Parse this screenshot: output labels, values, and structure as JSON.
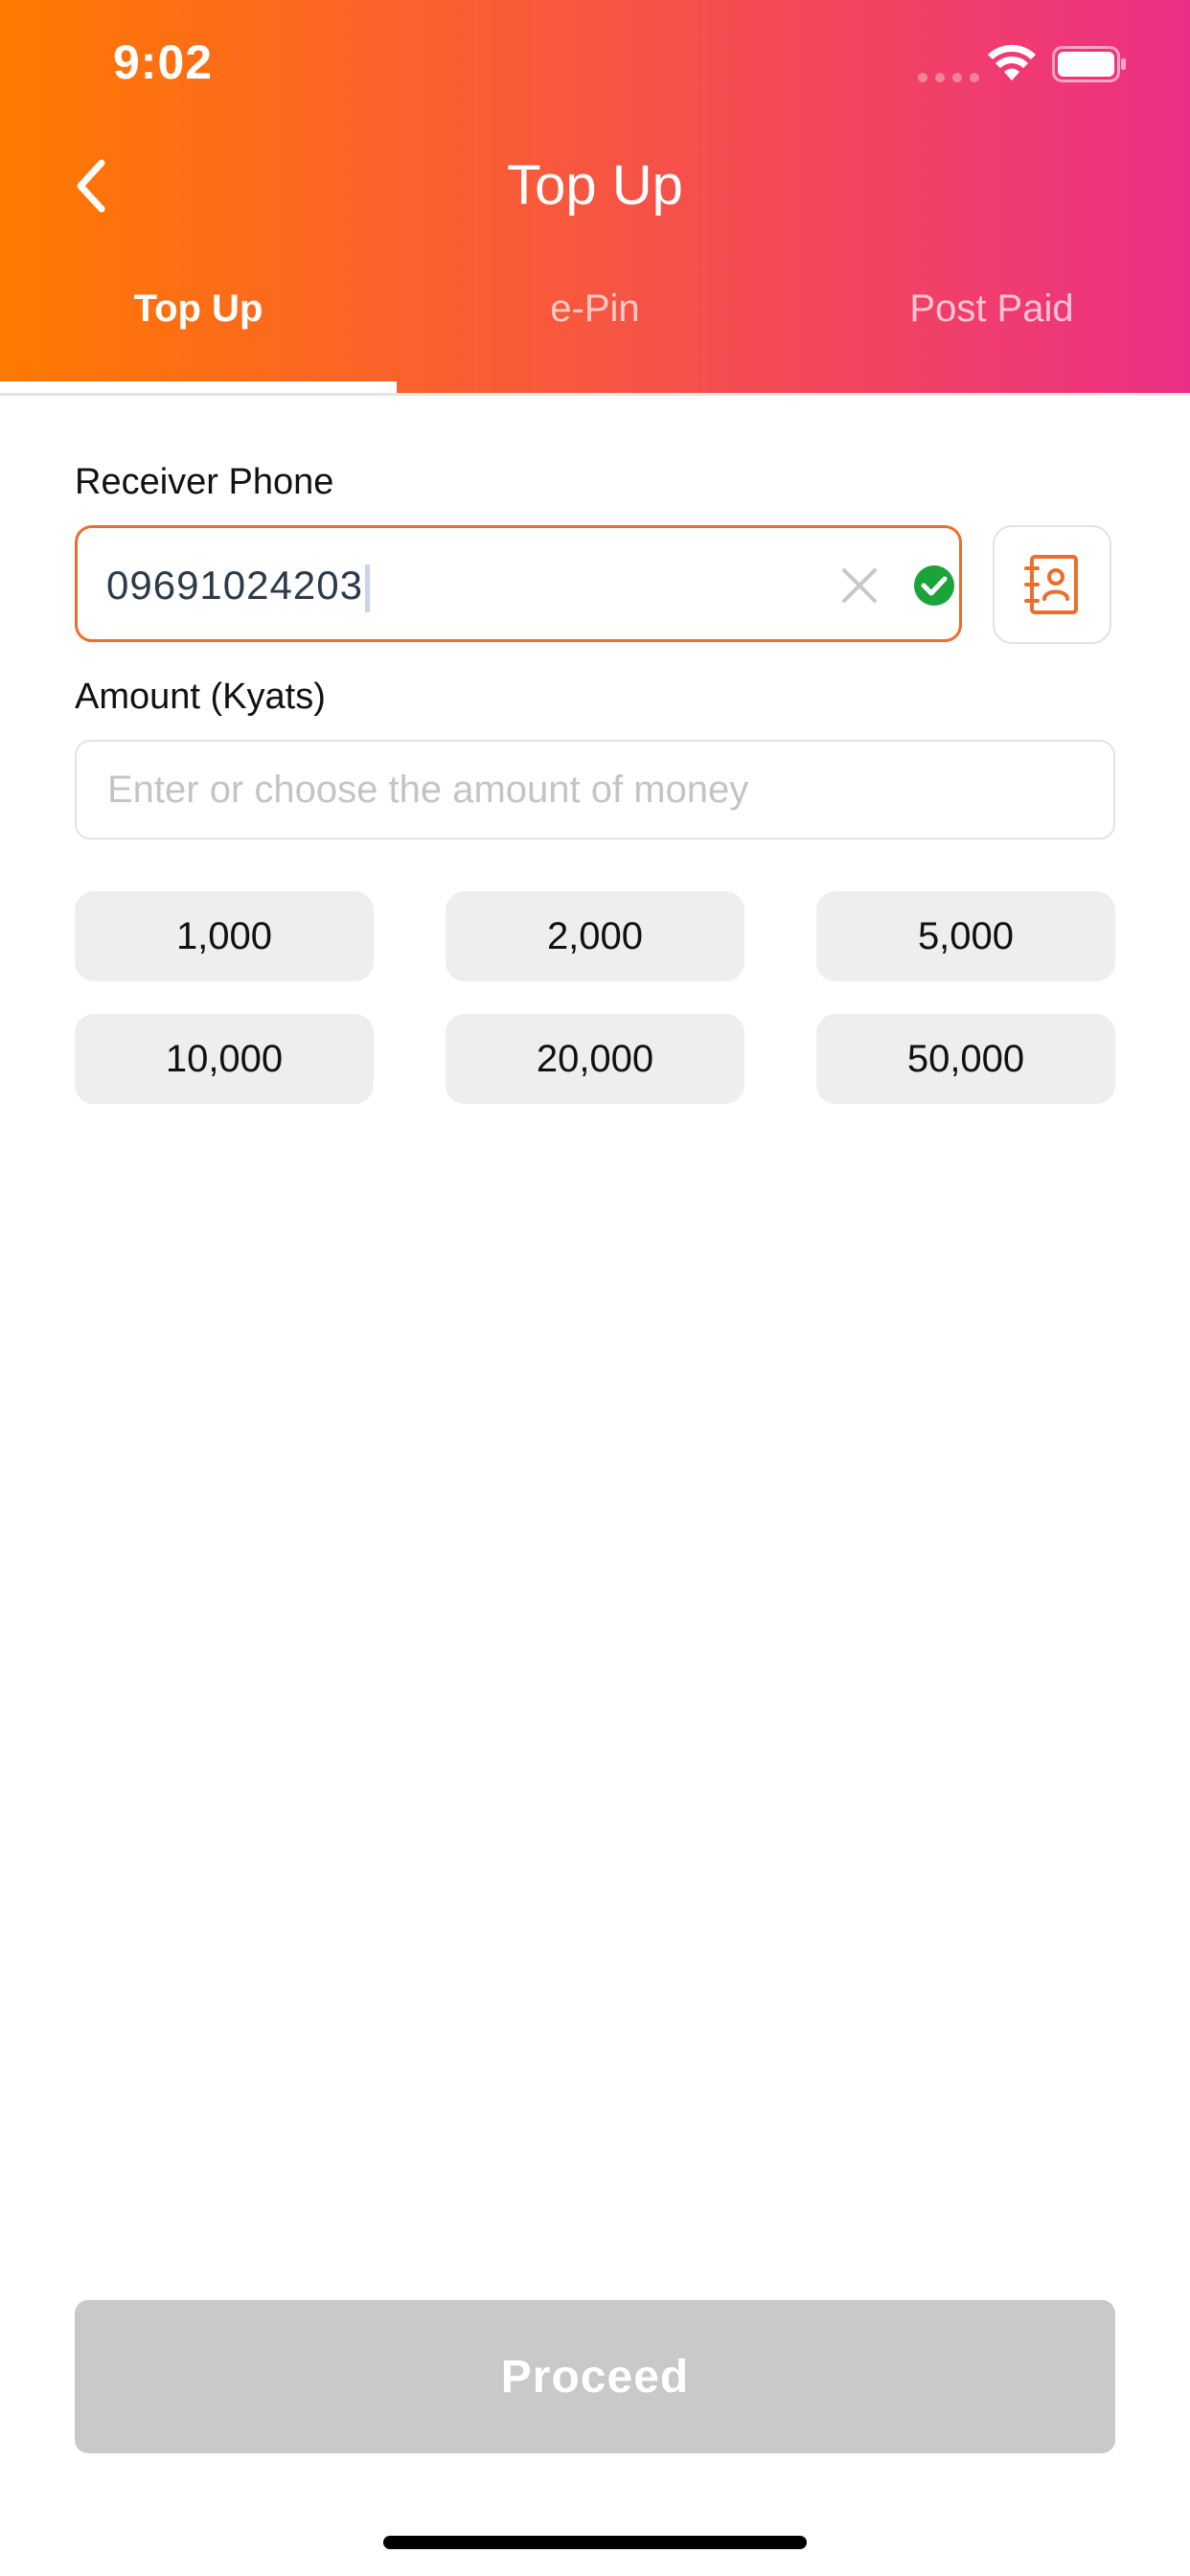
{
  "status_bar": {
    "time": "9:02"
  },
  "header": {
    "title": "Top Up",
    "tabs": [
      {
        "label": "Top Up",
        "active": true
      },
      {
        "label": "e-Pin",
        "active": false
      },
      {
        "label": "Post Paid",
        "active": false
      }
    ]
  },
  "form": {
    "phone_label": "Receiver Phone",
    "phone_value": "09691024203",
    "amount_label": "Amount (Kyats)",
    "amount_placeholder": "Enter or choose the amount of money",
    "amount_value": "",
    "amount_options": [
      "1,000",
      "2,000",
      "5,000",
      "10,000",
      "20,000",
      "50,000"
    ]
  },
  "actions": {
    "proceed_label": "Proceed"
  },
  "colors": {
    "gradient_start": "#ff7a00",
    "gradient_end": "#ec2f86",
    "input_focus_border": "#ec6e2c",
    "valid_check": "#1aa43a",
    "disabled_button": "#c9c9c9"
  },
  "icons": [
    "back-chevron-icon",
    "wifi-icon",
    "battery-icon",
    "clear-icon",
    "check-circle-icon",
    "contacts-book-icon"
  ]
}
